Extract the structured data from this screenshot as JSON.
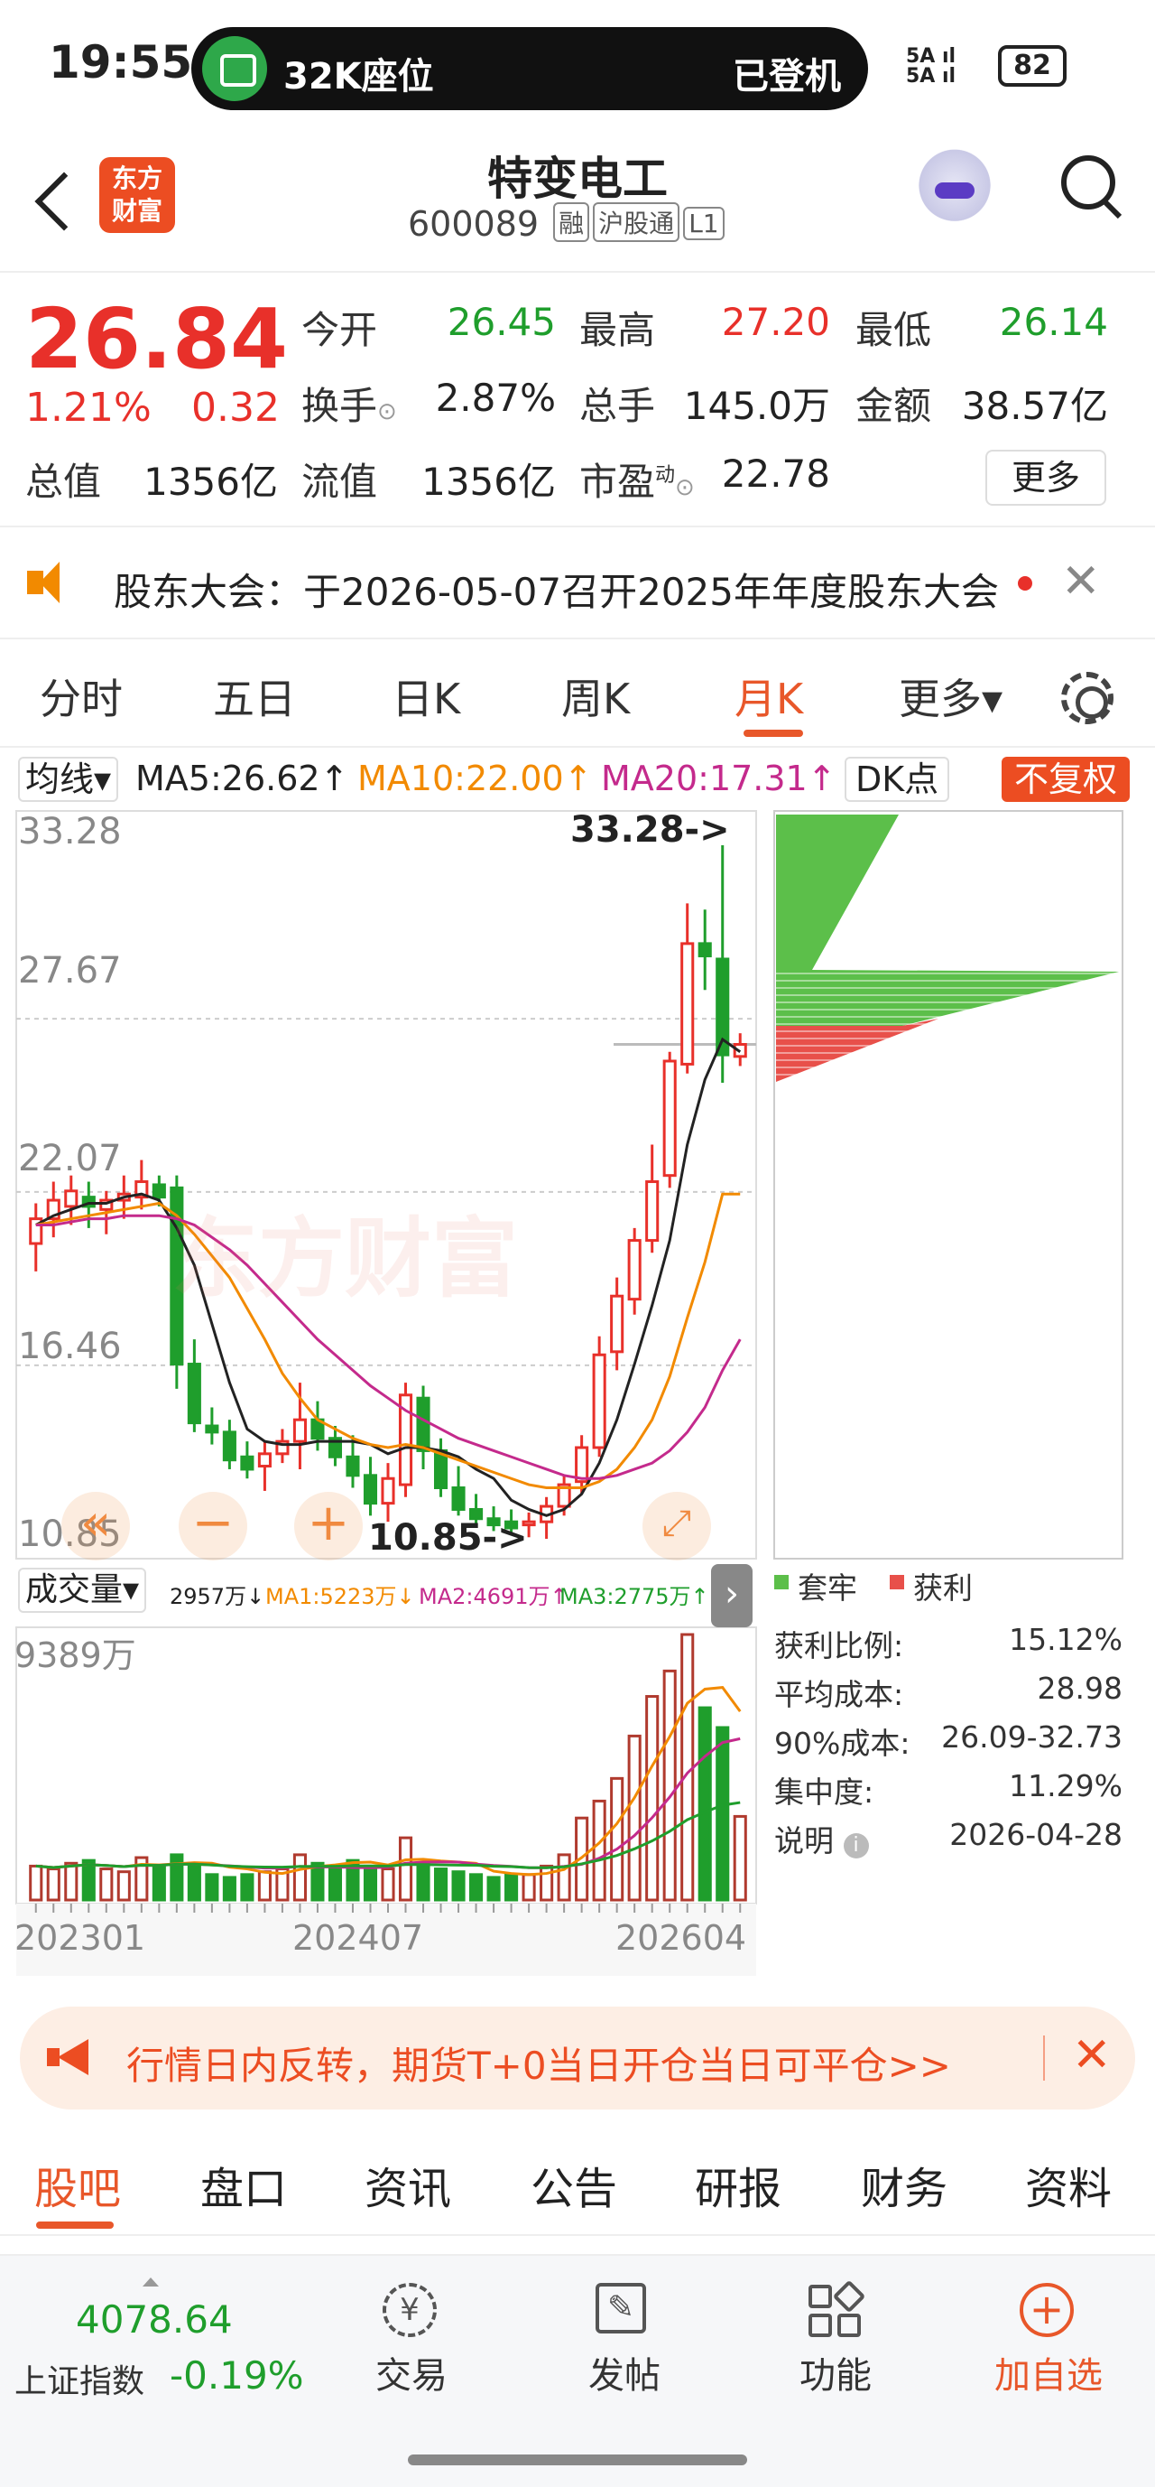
{
  "status_bar": {
    "time": "19:55",
    "pill_label": "32K座位",
    "pill_status": "已登机",
    "signal": "5A\n5A",
    "battery": "82"
  },
  "header": {
    "logo": "东方\n财富",
    "stock_name": "特变电工",
    "stock_code": "600089",
    "tags": [
      "融",
      "沪股通",
      "L1"
    ]
  },
  "quote": {
    "price": "26.84",
    "change_pct": "1.21%",
    "change": "0.32",
    "fields": [
      {
        "label": "今开",
        "value": "26.45",
        "color": "#1f9e2c"
      },
      {
        "label": "最高",
        "value": "27.20",
        "color": "#e8302a"
      },
      {
        "label": "最低",
        "value": "26.14",
        "color": "#1f9e2c"
      },
      {
        "label": "换手",
        "value": "2.87%",
        "color": "#222"
      },
      {
        "label": "总手",
        "value": "145.0万",
        "color": "#222"
      },
      {
        "label": "金额",
        "value": "38.57亿",
        "color": "#222"
      },
      {
        "label": "总值",
        "value": "1356亿",
        "color": "#222"
      },
      {
        "label": "流值",
        "value": "1356亿",
        "color": "#222"
      },
      {
        "label": "市盈",
        "value": "22.78",
        "color": "#222"
      }
    ],
    "pe_superscript": "动",
    "more_label": "更多"
  },
  "notice": {
    "text": "股东大会：于2026-05-07召开2025年年度股东大会",
    "close": "✕"
  },
  "kline_tabs": {
    "items": [
      "分时",
      "五日",
      "日K",
      "周K",
      "月K",
      "更多▾"
    ],
    "active": "月K"
  },
  "ma": {
    "select": "均线▾",
    "ma5": "MA5:26.62↑",
    "ma10": "MA10:22.00↑",
    "ma20": "MA20:17.31↑",
    "dk": "DK点",
    "fq": "不复权"
  },
  "colors": {
    "up": "#e8302a",
    "down": "#1f9e2c",
    "ma5": "#222222",
    "ma10": "#f28a00",
    "ma20": "#c42a8c",
    "accent": "#e8572a"
  },
  "chart_data": [
    {
      "type": "candlestick",
      "title": "月K",
      "y_ticks": [
        "33.28",
        "27.67",
        "22.07",
        "16.46",
        "10.85"
      ],
      "ylim": [
        10.85,
        33.28
      ],
      "annotations": {
        "high": "33.28->",
        "low": "10.85->"
      },
      "watermark": "东方财富",
      "candles": [
        [
          20.4,
          21.7,
          19.5,
          21.2
        ],
        [
          21.2,
          22.4,
          20.6,
          21.8
        ],
        [
          21.6,
          22.6,
          21.0,
          22.1
        ],
        [
          21.9,
          22.4,
          20.9,
          21.6
        ],
        [
          21.5,
          22.1,
          20.7,
          21.8
        ],
        [
          21.8,
          22.6,
          21.2,
          22.0
        ],
        [
          21.9,
          23.1,
          21.5,
          22.4
        ],
        [
          22.3,
          22.6,
          21.6,
          21.9
        ],
        [
          22.2,
          22.6,
          15.7,
          16.5
        ],
        [
          16.5,
          17.3,
          14.3,
          14.6
        ],
        [
          14.5,
          15.1,
          13.9,
          14.3
        ],
        [
          14.3,
          14.7,
          13.1,
          13.4
        ],
        [
          13.5,
          14.0,
          12.8,
          13.1
        ],
        [
          13.2,
          14.0,
          12.4,
          13.6
        ],
        [
          13.6,
          14.4,
          13.3,
          14.0
        ],
        [
          14.0,
          15.9,
          13.1,
          14.7
        ],
        [
          14.7,
          15.3,
          13.7,
          14.1
        ],
        [
          14.1,
          14.5,
          13.2,
          13.5
        ],
        [
          13.5,
          14.2,
          12.5,
          12.9
        ],
        [
          12.9,
          13.5,
          11.6,
          12.0
        ],
        [
          12.0,
          13.3,
          11.4,
          12.8
        ],
        [
          12.6,
          15.9,
          12.2,
          15.5
        ],
        [
          15.4,
          15.8,
          13.1,
          13.7
        ],
        [
          13.7,
          14.1,
          12.2,
          12.5
        ],
        [
          12.5,
          13.2,
          11.6,
          11.8
        ],
        [
          11.8,
          12.3,
          11.3,
          11.5
        ],
        [
          11.5,
          11.9,
          11.1,
          11.3
        ],
        [
          11.4,
          11.8,
          11.0,
          11.2
        ],
        [
          11.3,
          11.7,
          10.9,
          11.4
        ],
        [
          11.4,
          12.2,
          10.85,
          11.9
        ],
        [
          11.9,
          12.9,
          11.6,
          12.6
        ],
        [
          12.7,
          14.2,
          12.3,
          13.8
        ],
        [
          13.8,
          17.4,
          13.5,
          16.8
        ],
        [
          16.9,
          19.3,
          16.3,
          18.7
        ],
        [
          18.6,
          20.9,
          18.1,
          20.5
        ],
        [
          20.5,
          23.6,
          20.1,
          22.4
        ],
        [
          22.6,
          26.6,
          22.2,
          26.3
        ],
        [
          26.2,
          31.4,
          25.9,
          30.1
        ],
        [
          30.1,
          31.2,
          28.6,
          29.7
        ],
        [
          29.6,
          33.28,
          25.6,
          26.5
        ],
        [
          26.45,
          27.2,
          26.14,
          26.84
        ]
      ],
      "series": [
        {
          "name": "MA5",
          "values": [
            21.0,
            21.3,
            21.5,
            21.7,
            21.7,
            21.9,
            22.0,
            21.8,
            20.9,
            19.7,
            17.8,
            15.9,
            14.4,
            14.0,
            13.9,
            13.9,
            14.0,
            14.0,
            14.0,
            13.9,
            13.6,
            13.8,
            13.8,
            13.7,
            13.5,
            13.1,
            12.8,
            12.1,
            11.8,
            11.6,
            11.8,
            12.3,
            13.3,
            14.7,
            16.5,
            18.4,
            20.5,
            23.6,
            25.7,
            27.0,
            26.6
          ]
        },
        {
          "name": "MA10",
          "values": [
            21.0,
            21.1,
            21.2,
            21.3,
            21.4,
            21.5,
            21.6,
            21.7,
            21.3,
            20.7,
            20.0,
            19.3,
            18.3,
            17.3,
            16.2,
            15.4,
            14.7,
            14.4,
            14.1,
            13.9,
            13.8,
            13.9,
            13.8,
            13.6,
            13.4,
            13.2,
            13.0,
            12.8,
            12.6,
            12.5,
            12.5,
            12.5,
            12.7,
            13.1,
            13.8,
            14.7,
            16.1,
            18.0,
            19.8,
            22.0,
            22.0
          ]
        },
        {
          "name": "MA20",
          "values": [
            21.0,
            21.0,
            21.1,
            21.2,
            21.2,
            21.3,
            21.3,
            21.3,
            21.2,
            21.0,
            20.6,
            20.2,
            19.7,
            19.1,
            18.5,
            17.9,
            17.3,
            16.8,
            16.3,
            15.8,
            15.4,
            15.0,
            14.7,
            14.4,
            14.1,
            13.9,
            13.7,
            13.5,
            13.3,
            13.1,
            12.9,
            12.8,
            12.8,
            12.9,
            13.1,
            13.3,
            13.7,
            14.3,
            15.1,
            16.3,
            17.3
          ]
        }
      ]
    },
    {
      "type": "bar",
      "title": "成交量",
      "legend": {
        "select": "成交量▾",
        "vol": "2957万↓",
        "ma1": "MA1:5223万↓",
        "ma2": "MA2:4691万↑",
        "ma3": "MA3:2775万↑"
      },
      "y_max_label": "9389万",
      "x_labels": [
        "202301",
        "202407",
        "202604"
      ],
      "volumes": [
        1200,
        1100,
        1300,
        1400,
        1100,
        1000,
        1500,
        1200,
        1600,
        1300,
        900,
        800,
        900,
        1000,
        1100,
        1600,
        1300,
        1200,
        1400,
        1200,
        1100,
        2200,
        1300,
        1100,
        1000,
        900,
        800,
        900,
        900,
        1200,
        1600,
        2900,
        3500,
        4300,
        5800,
        7200,
        8100,
        9389,
        6800,
        6100,
        2957
      ],
      "colors_up": "#b03a2e",
      "colors_down": "#1f9e2c"
    },
    {
      "type": "bar",
      "title": "筹码分布",
      "legend": [
        {
          "name": "套牢",
          "color": "#5cbf4a"
        },
        {
          "name": "获利",
          "color": "#e8504a"
        }
      ],
      "stats": [
        {
          "label": "获利比例:",
          "value": "15.12%"
        },
        {
          "label": "平均成本:",
          "value": "28.98"
        },
        {
          "label": "90%成本:",
          "value": "26.09-32.73"
        },
        {
          "label": "集中度:",
          "value": "11.29%"
        },
        {
          "label": "说明",
          "value": "2026-04-28"
        }
      ]
    }
  ],
  "banner": {
    "text": "行情日内反转，期货T+0当日开仓当日可平仓>>",
    "close": "✕"
  },
  "bottom_tabs": {
    "items": [
      "股吧",
      "盘口",
      "资讯",
      "公告",
      "研报",
      "财务",
      "资料"
    ],
    "active": "股吧"
  },
  "bottom_bar": {
    "index_value": "4078.64",
    "index_name": "上证指数",
    "index_pct": "-0.19%",
    "buttons": [
      {
        "label": "交易",
        "icon": "yen-icon"
      },
      {
        "label": "发帖",
        "icon": "edit-icon"
      },
      {
        "label": "功能",
        "icon": "grid-icon"
      },
      {
        "label": "加自选",
        "icon": "add-circle-icon"
      }
    ]
  }
}
